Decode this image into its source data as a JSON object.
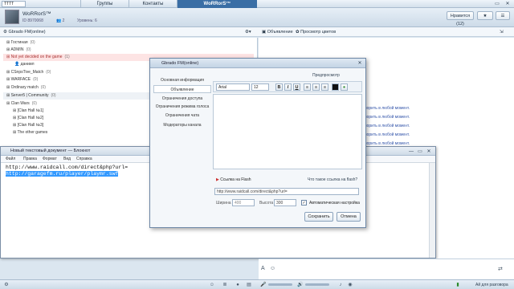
{
  "topbar": {
    "window_title": "ТТТТ",
    "tabs": [
      "Группы",
      "Контакты",
      "WoRRorS™"
    ],
    "controls": [
      "▭",
      "✕"
    ]
  },
  "channel": {
    "name": "WoRRorS™",
    "id_label": "ID",
    "id_value": "8970068",
    "members": "2",
    "level": "Уровень: 6",
    "like_button": "Нравится (12)",
    "star_button": "★",
    "menu_button": "☰"
  },
  "subbar": {
    "channel_path": "Gbrado FM(online)",
    "announce": "Объявление",
    "browse_colors": "Просмотр цветов"
  },
  "tree": [
    {
      "label": "Гостиная",
      "count": "(0)",
      "style": "normal"
    },
    {
      "label": "ADMIN",
      "count": "(0)",
      "style": "normal"
    },
    {
      "label": "Not yet decided on the game",
      "count": "(1)",
      "style": "hl"
    },
    {
      "label": "даниил",
      "count": "",
      "style": "normal"
    },
    {
      "label": "CSnpsTive_Match",
      "count": "(0)",
      "style": "normal"
    },
    {
      "label": "WARFACE",
      "count": "(0)",
      "style": "normal"
    },
    {
      "label": "Ordinary match",
      "count": "(0)",
      "style": "normal"
    },
    {
      "label": "Server5 | Community",
      "count": "(0)",
      "style": "gray"
    },
    {
      "label": "Clan Wars",
      "count": "(0)",
      "style": "normal"
    },
    {
      "label": "[Clan Hall №1]",
      "count": "",
      "style": "normal"
    },
    {
      "label": "[Clan Hall №2]",
      "count": "",
      "style": "normal"
    },
    {
      "label": "[Clan Hall №3]",
      "count": "",
      "style": "normal"
    },
    {
      "label": "The other games",
      "count": "",
      "style": "normal"
    }
  ],
  "right_messages": [
    "ворить в любой момент.",
    "ворить в любой момент.",
    "ворить в любой момент.",
    "ворить в любой момент.",
    "ворить в любой момент.",
    "ворить в любой момент."
  ],
  "notepad": {
    "title": "Новый текстовый документ — Блокнот",
    "menu": [
      "Файл",
      "Правка",
      "Формат",
      "Вид",
      "Справка"
    ],
    "line1": "http://www.raidcall.com/direct&php?url=",
    "line2": "http://garagefm.ru/player/playmr.swf",
    "controls": [
      "—",
      "▭",
      "✕"
    ]
  },
  "dialog": {
    "title": "Gbrado FM(online)",
    "nav": [
      "Основная информация",
      "Объявление",
      "Ограничения доступа",
      "Ограничения режима голоса",
      "Ограничения чата",
      "Модераторы канала"
    ],
    "preview": "Предпросмотр",
    "font": "Arial",
    "size": "12",
    "format_buttons": [
      "B",
      "I",
      "U"
    ],
    "flash_link": "Ссылка на Flash",
    "flash_help": "Что такое ссылка на flash?",
    "url_value": "http://www.raidcall.com/direct&php?url=",
    "width_label": "Ширина",
    "width_value": "400",
    "height_label": "Высота",
    "height_value": "300",
    "auto_label": "Автоматическая настройка",
    "save": "Сохранить",
    "cancel": "Отмена"
  },
  "status": {
    "right_text": "Ай для разговора"
  },
  "colors": {
    "accent": "#3a6ea5",
    "highlight": "#3399ff"
  }
}
